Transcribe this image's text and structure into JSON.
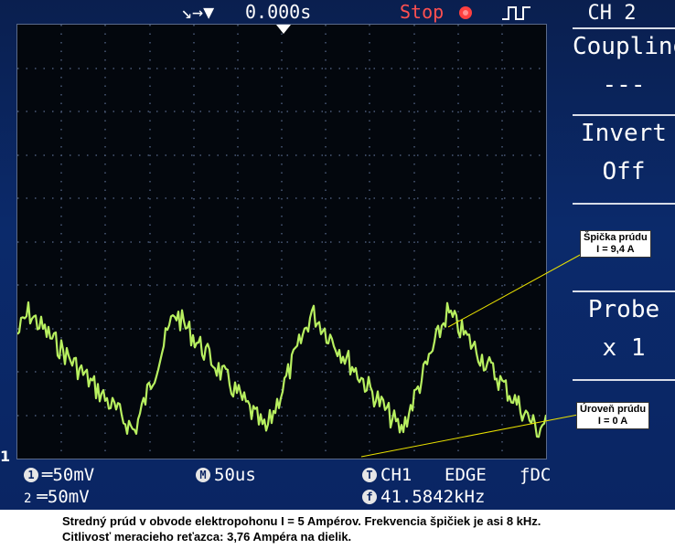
{
  "topbar": {
    "trigger_icons": "↘→▼",
    "time_offset": "0.000s",
    "run_state": "Stop",
    "run_state_color": "#ff4040",
    "trigger_symbol_icon": "pulse-icon",
    "channel": "CH 2"
  },
  "menu": {
    "items": [
      {
        "label": "Coupling",
        "value": "---"
      },
      {
        "label": "Invert",
        "value": "Off"
      },
      {
        "label": "",
        "value": ""
      },
      {
        "label": "Probe",
        "value": "x 1"
      },
      {
        "label": "",
        "value": ""
      }
    ]
  },
  "status": {
    "ch1_index": "1",
    "ch1_coupling": "═",
    "ch1_scale": "50mV",
    "ch2_index": "2",
    "ch2_coupling": "═",
    "ch2_scale": "50mV",
    "timebase_badge": "M",
    "timebase": "50us",
    "trigger_badge": "T",
    "trigger_source": "CH1",
    "trigger_mode": "EDGE",
    "trigger_edge": "ƒ",
    "trigger_coupling": "DC",
    "freq_badge": "f",
    "frequency": "41.5842kHz"
  },
  "annotations": {
    "peak_title": "Špička prúdu",
    "peak_value": "I = 9,4 A",
    "zero_title": "Úroveň prúdu",
    "zero_value": "I = 0 A"
  },
  "caption": {
    "line1": "Stredný prúd v obvode elektropohonu I = 5 Ampérov. Frekvencia špičiek je asi 8 kHz.",
    "line2": "Citlivosť meracieho reťazca: 3,76 Ampéra na dielik."
  },
  "colors": {
    "trace": "#b8f060",
    "screen_bg": "#03070d",
    "frame_bg": "#0b2a6b",
    "grid_dots": "#4a5a78"
  }
}
